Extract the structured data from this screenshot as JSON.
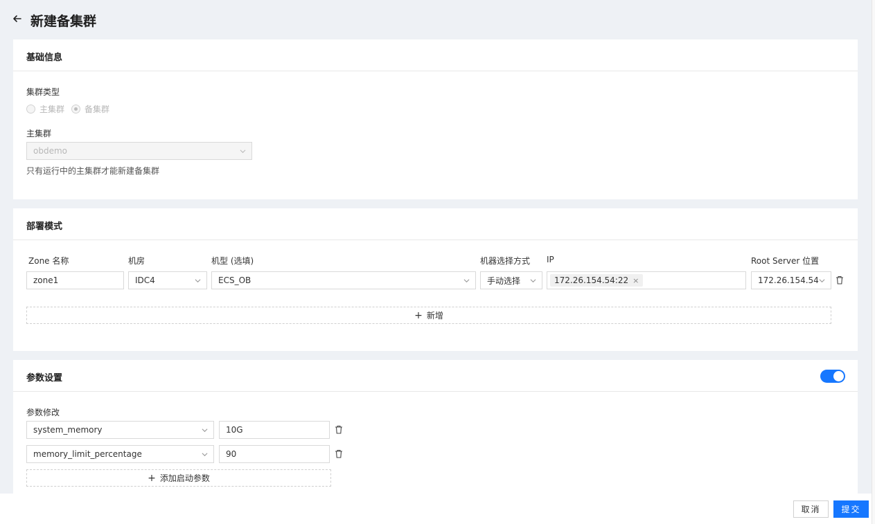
{
  "page": {
    "title": "新建备集群"
  },
  "basic": {
    "section_title": "基础信息",
    "cluster_type_label": "集群类型",
    "radio_primary": "主集群",
    "radio_standby": "备集群",
    "selected_type": "备集群",
    "primary_cluster_label": "主集群",
    "primary_cluster_value": "obdemo",
    "hint": "只有运行中的主集群才能新建备集群"
  },
  "deploy": {
    "section_title": "部署模式",
    "columns": {
      "zone": "Zone 名称",
      "idc": "机房",
      "model": "机型 (选填)",
      "select_mode": "机器选择方式",
      "ip": "IP",
      "root_server": "Root Server 位置"
    },
    "row": {
      "zone": "zone1",
      "idc": "IDC4",
      "model": "ECS_OB",
      "select_mode": "手动选择",
      "ip_tag": "172.26.154.54:22",
      "root_server": "172.26.154.54"
    },
    "add_label": "新增"
  },
  "params": {
    "section_title": "参数设置",
    "toggle_on": true,
    "modify_label": "参数修改",
    "items": [
      {
        "name": "system_memory",
        "value": "10G"
      },
      {
        "name": "memory_limit_percentage",
        "value": "90"
      }
    ],
    "add_label": "添加启动参数"
  },
  "footer": {
    "cancel": "取消",
    "submit": "提交"
  },
  "colors": {
    "primary": "#1677ff",
    "background": "#eef1f5"
  }
}
